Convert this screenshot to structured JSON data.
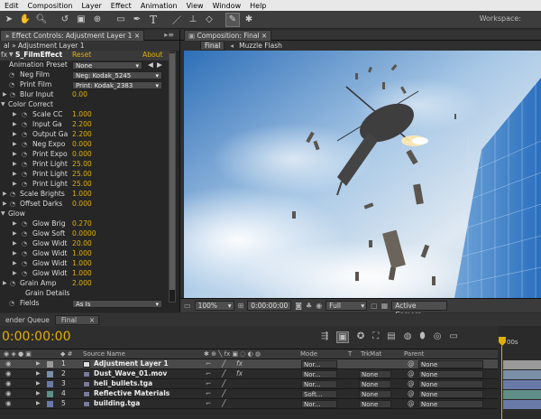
{
  "menu": [
    "Edit",
    "Composition",
    "Layer",
    "Effect",
    "Animation",
    "View",
    "Window",
    "Help"
  ],
  "workspace_label": "Workspace:",
  "effect_panel": {
    "tab": "Effect Controls: Adjustment Layer 1",
    "layer": "al » Adjustment Layer 1",
    "effect_name": "S_FilmEffect",
    "reset": "Reset",
    "about": "About",
    "animation_preset_label": "Animation Preset",
    "animation_preset_value": "None",
    "neg_film_label": "Neg Film",
    "neg_film_value": "Neg: Kodak_5245",
    "print_film_label": "Print Film",
    "print_film_value": "Print: Kodak_2383",
    "blur_input_label": "Blur Input",
    "blur_input_value": "0.00",
    "color_correct": "Color Correct",
    "cc_params": [
      {
        "label": "Scale CC",
        "value": "1.000"
      },
      {
        "label": "Input Ga",
        "value": "2.200"
      },
      {
        "label": "Output Ga",
        "value": "2.200"
      },
      {
        "label": "Neg Expo",
        "value": "0.000"
      },
      {
        "label": "Print Expo",
        "value": "0.000"
      },
      {
        "label": "Print Light",
        "value": "25.00"
      },
      {
        "label": "Print Light",
        "value": "25.00"
      },
      {
        "label": "Print Light",
        "value": "25.00"
      }
    ],
    "scale_brights_label": "Scale Brights",
    "scale_brights_value": "1.000",
    "offset_darks_label": "Offset Darks",
    "offset_darks_value": "0.000",
    "glow_label": "Glow",
    "glow_params": [
      {
        "label": "Glow Brig",
        "value": "0.270"
      },
      {
        "label": "Glow Soft",
        "value": "0.0000"
      },
      {
        "label": "Glow Widt",
        "value": "20.00"
      },
      {
        "label": "Glow Widt",
        "value": "1.000"
      },
      {
        "label": "Glow Widt",
        "value": "1.000"
      },
      {
        "label": "Glow Widt",
        "value": "1.000"
      }
    ],
    "grain_amp_label": "Grain Amp",
    "grain_amp_value": "2.000",
    "grain_details_label": "Grain Details",
    "fields_label": "Fields",
    "fields_value": "As Is"
  },
  "comp_panel": {
    "tab": "Composition: Final",
    "crumb_final": "Final",
    "crumb_child": "Muzzle Flash",
    "zoom": "100%",
    "timecode": "0:00:00:00",
    "resolution": "Full",
    "camera": "Active Camera"
  },
  "timeline": {
    "tab_render": "ender Queue",
    "tab_final": "Final",
    "timecode": "0:00:00:00",
    "ruler_start": "00s",
    "col_source": "Source Name",
    "col_mode": "Mode",
    "col_t": "T",
    "col_trkmat": "TrkMat",
    "col_parent": "Parent",
    "layers": [
      {
        "num": "1",
        "name": "Adjustment Layer 1",
        "mode": "Nor...",
        "trkmat": "",
        "parent": "None",
        "color": "#9a9a9a"
      },
      {
        "num": "2",
        "name": "Dust_Wave_01.mov",
        "mode": "Nor...",
        "trkmat": "None",
        "parent": "None",
        "color": "#7a8fa8"
      },
      {
        "num": "3",
        "name": "heli_bullets.tga",
        "mode": "Nor...",
        "trkmat": "None",
        "parent": "None",
        "color": "#6a7aa8"
      },
      {
        "num": "4",
        "name": "Reflective Materials",
        "mode": "Soft...",
        "trkmat": "None",
        "parent": "None",
        "color": "#5f8f88"
      },
      {
        "num": "5",
        "name": "building.tga",
        "mode": "Nor...",
        "trkmat": "None",
        "parent": "None",
        "color": "#6a7aa8"
      }
    ]
  }
}
